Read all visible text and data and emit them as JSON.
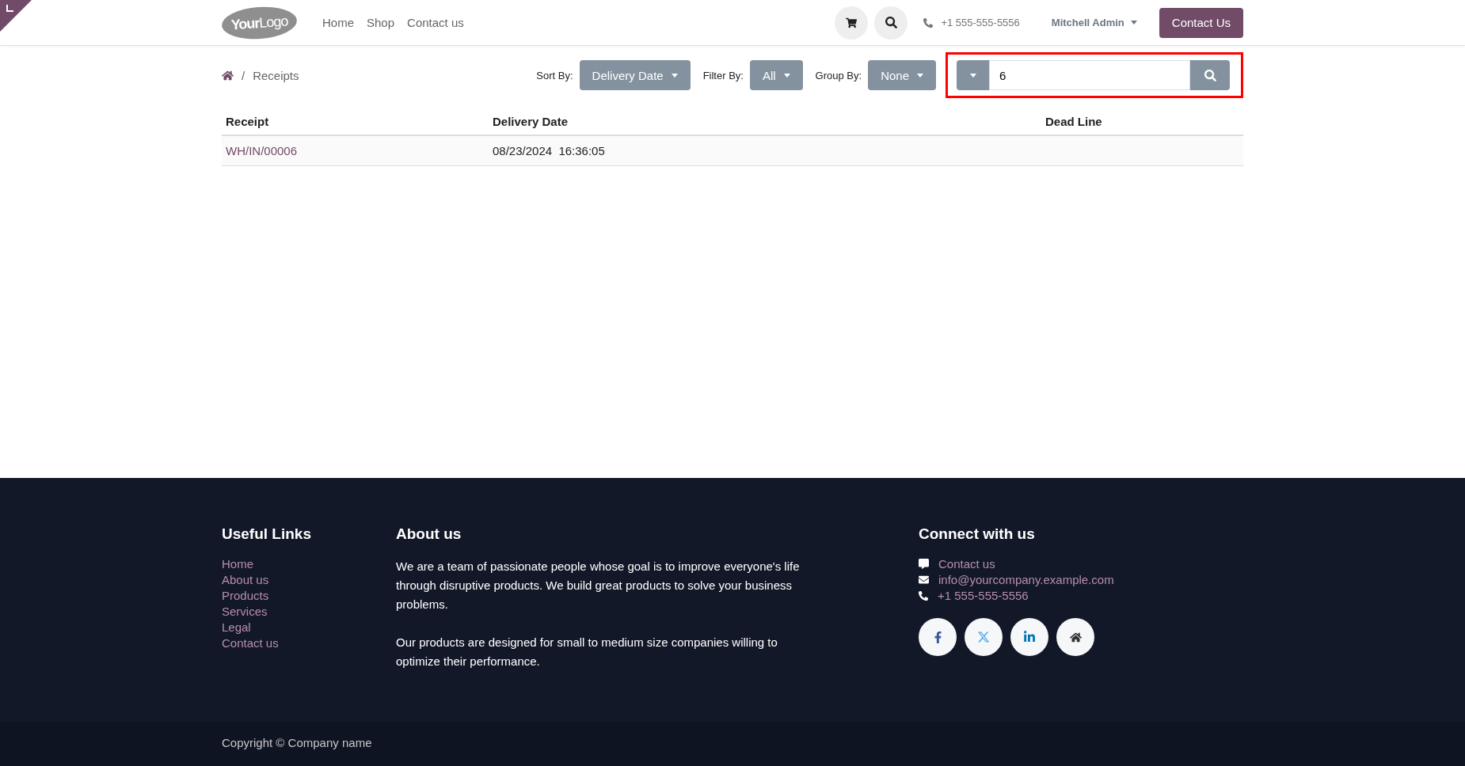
{
  "header": {
    "logo": {
      "text_bold": "Your",
      "text_light": "Logo"
    },
    "nav": [
      {
        "label": "Home"
      },
      {
        "label": "Shop"
      },
      {
        "label": "Contact us"
      }
    ],
    "phone": "+1 555-555-5556",
    "user": "Mitchell Admin",
    "cta": "Contact Us"
  },
  "breadcrumb": {
    "separator": "/",
    "current": "Receipts"
  },
  "controls": [
    {
      "label": "Sort By:",
      "value": "Delivery Date"
    },
    {
      "label": "Filter By:",
      "value": "All"
    },
    {
      "label": "Group By:",
      "value": "None"
    }
  ],
  "search": {
    "value": "6",
    "highlighted": true
  },
  "table": {
    "columns": [
      "Receipt",
      "Delivery Date",
      "Dead Line"
    ],
    "rows": [
      {
        "receipt": "WH/IN/00006",
        "delivery_date": "08/23/2024  16:36:05"
      }
    ]
  },
  "footer": {
    "links_title": "Useful Links",
    "links": [
      "Home",
      "About us",
      "Products",
      "Services",
      "Legal",
      "Contact us"
    ],
    "about_title": "About us",
    "about": [
      "We are a team of passionate people whose goal is to improve everyone's life through disruptive products. We build great products to solve your business problems.",
      "Our products are designed for small to medium size companies willing to optimize their performance."
    ],
    "connect_title": "Connect with us",
    "contacts": [
      {
        "kind": "chat",
        "text": "Contact us"
      },
      {
        "kind": "mail",
        "text": "info@yourcompany.example.com"
      },
      {
        "kind": "phone",
        "text": "+1 555-555-5556"
      }
    ],
    "socials": [
      {
        "kind": "facebook"
      },
      {
        "kind": "x"
      },
      {
        "kind": "linkedin"
      },
      {
        "kind": "home"
      }
    ],
    "copyright": "Copyright © Company name"
  }
}
